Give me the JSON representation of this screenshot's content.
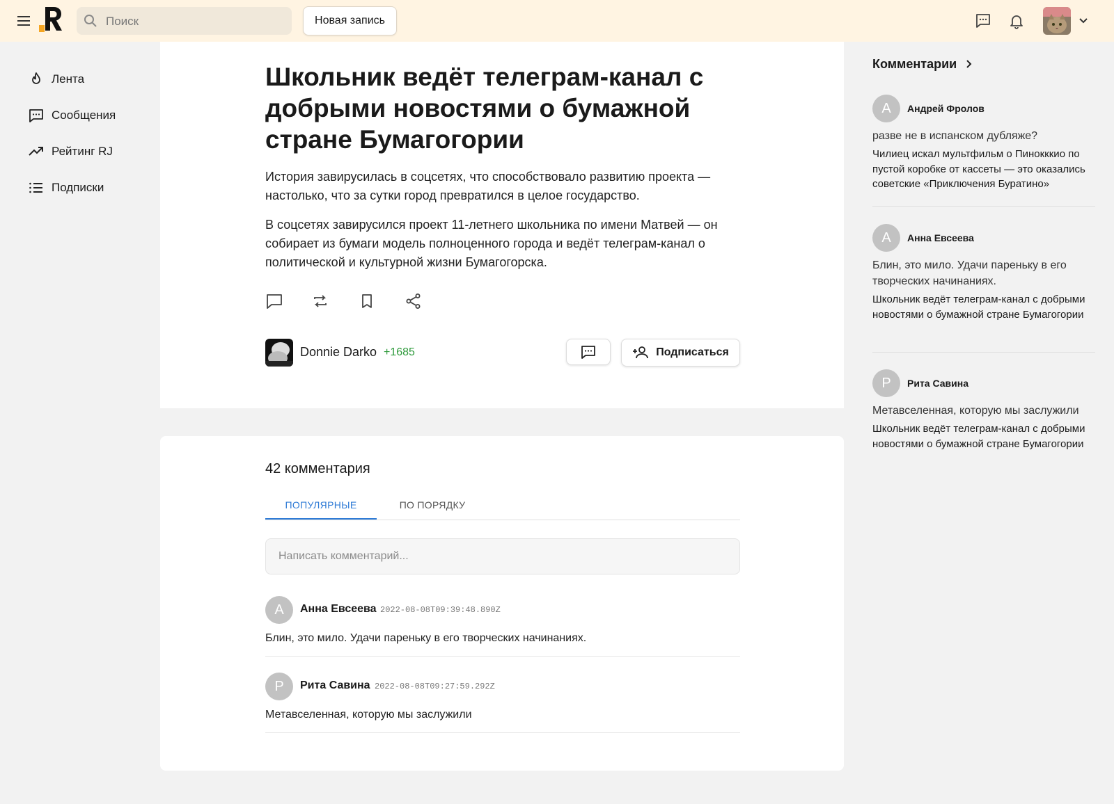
{
  "header": {
    "search_placeholder": "Поиск",
    "new_post_label": "Новая запись",
    "brand_color": "#fff4e2"
  },
  "nav": {
    "items": [
      {
        "label": "Лента",
        "icon": "fire-icon"
      },
      {
        "label": "Сообщения",
        "icon": "chat-icon"
      },
      {
        "label": "Рейтинг RJ",
        "icon": "trending-up-icon"
      },
      {
        "label": "Подписки",
        "icon": "list-icon"
      }
    ]
  },
  "article": {
    "title": "Школьник ведёт телеграм-канал с добрыми новостями о бумажной стране Бумагогории",
    "lead": "История завирусилась в соцсетях, что способствовало развитию проекта — настолько, что за сутки город превратился в целое государство.",
    "body": "В соцсетях завирусился проект 11-летнего школьника по имени Матвей — он собирает из бумаги модель полноценного города и ведёт телеграм-канал о политической и культурной жизни Бумагогорска.",
    "author": {
      "name": "Donnie Darko",
      "rating": "+1685"
    },
    "subscribe_label": "Подписаться"
  },
  "comments": {
    "count_label": "42 комментария",
    "tabs": [
      {
        "label": "ПОПУЛЯРНЫЕ",
        "active": true
      },
      {
        "label": "ПО ПОРЯДКУ",
        "active": false
      }
    ],
    "input_placeholder": "Написать комментарий...",
    "items": [
      {
        "initial": "А",
        "author": "Анна Евсеева",
        "time": "2022-08-08T09:39:48.890Z",
        "text": "Блин, это мило. Удачи пареньку в его творческих начинаниях."
      },
      {
        "initial": "Р",
        "author": "Рита Савина",
        "time": "2022-08-08T09:27:59.292Z",
        "text": "Метавселенная, которую мы заслужили"
      }
    ]
  },
  "sidebar": {
    "title": "Комментарии",
    "items": [
      {
        "initial": "А",
        "author": "Андрей Фролов",
        "text": "разве не в испанском дубляже?",
        "post": "Чилиец искал мультфильм о Пинокккио по пустой коробке от кассеты — это оказались советские «Приключения Буратино»"
      },
      {
        "initial": "А",
        "author": "Анна Евсеева",
        "text": "Блин, это мило. Удачи пареньку в его творческих начинаниях.",
        "post": "Школьник ведёт телеграм-канал с добрыми новостями о бумажной стране Бумагогории"
      },
      {
        "initial": "Р",
        "author": "Рита Савина",
        "text": "Метавселенная, которую мы заслужили",
        "post": "Школьник ведёт телеграм-канал с добрыми новостями о бумажной стране Бумагогории"
      }
    ]
  }
}
